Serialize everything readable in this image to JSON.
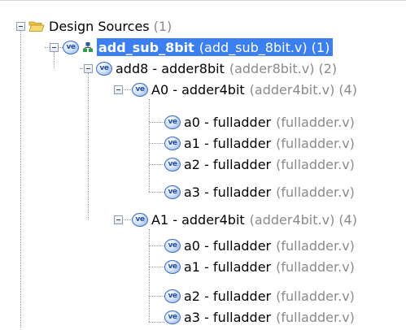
{
  "tree": {
    "root": {
      "label": "Design Sources",
      "count": "(1)",
      "icon": "folder-open-icon"
    },
    "top": {
      "label": "add_sub_8bit",
      "file": "(add_sub_8bit.v)",
      "count": "(1)",
      "icon": "verilog-module-icon",
      "secondary_icon": "hierarchy-icon",
      "selected": true
    },
    "adder8": {
      "label": "add8 - adder8bit",
      "file": "(adder8bit.v)",
      "count": "(2)",
      "icon": "verilog-module-icon"
    },
    "a0_group": {
      "label": "A0 - adder4bit",
      "file": "(adder4bit.v)",
      "count": "(4)",
      "icon": "verilog-module-icon",
      "children": [
        {
          "label": "a0 - fulladder",
          "file": "(fulladder.v)"
        },
        {
          "label": "a1 - fulladder",
          "file": "(fulladder.v)"
        },
        {
          "label": "a2 - fulladder",
          "file": "(fulladder.v)"
        },
        {
          "label": "a3 - fulladder",
          "file": "(fulladder.v)"
        }
      ]
    },
    "a1_group": {
      "label": "A1 - adder4bit",
      "file": "(adder4bit.v)",
      "count": "(4)",
      "icon": "verilog-module-icon",
      "children": [
        {
          "label": "a0 - fulladder",
          "file": "(fulladder.v)"
        },
        {
          "label": "a1 - fulladder",
          "file": "(fulladder.v)"
        },
        {
          "label": "a2 - fulladder",
          "file": "(fulladder.v)"
        },
        {
          "label": "a3 - fulladder",
          "file": "(fulladder.v)"
        }
      ]
    },
    "icon_text": "ve",
    "colors": {
      "selection": "#3b7ff0",
      "file_text": "#8a8a8a",
      "icon_border": "#3f6ec2"
    }
  }
}
